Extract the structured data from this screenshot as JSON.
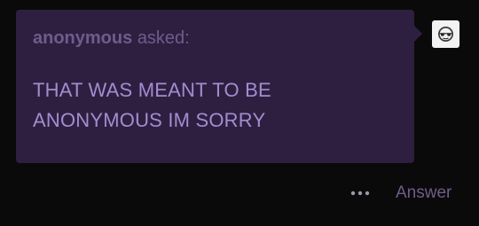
{
  "ask": {
    "asker_name": "anonymous",
    "asked_label": "asked:",
    "question_line1": "THAT WAS MEANT TO BE",
    "question_line2": "ANONYMOUS IM SORRY",
    "avatar_icon": "anonymous-sunglasses-avatar-icon"
  },
  "actions": {
    "more_icon": "ellipsis-icon",
    "answer_label": "Answer"
  },
  "colors": {
    "background": "#0a0a0a",
    "bubble": "#2e1f40",
    "muted_purple": "#6f5c8c",
    "question_purple": "#a58bd0"
  }
}
